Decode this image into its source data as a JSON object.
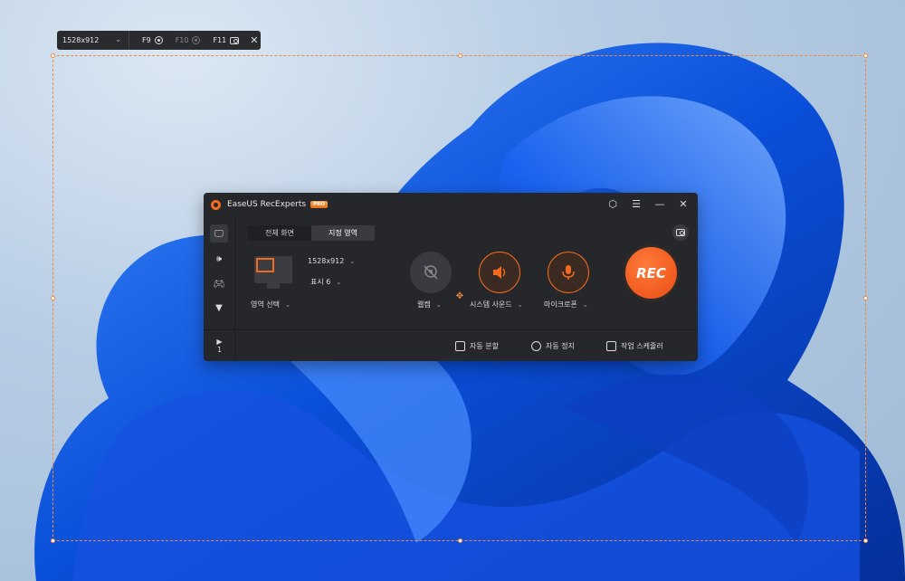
{
  "mini_toolbar": {
    "resolution": "1528x912",
    "items": [
      {
        "key": "F9",
        "icon": "record-circle-icon"
      },
      {
        "key": "F10",
        "icon": "pause-circle-icon"
      },
      {
        "key": "F11",
        "icon": "camera-icon"
      }
    ],
    "close_icon": "close-icon"
  },
  "app": {
    "title": "EaseUS RecExperts",
    "badge": "PRO",
    "window_controls": [
      "settings-icon",
      "menu-icon",
      "minimize-icon",
      "close-icon"
    ],
    "sidebar": {
      "items": [
        "monitor-icon",
        "speaker-icon",
        "gamepad-icon",
        "more-down-icon"
      ],
      "files_count": "1"
    },
    "tabs": [
      {
        "label": "전체 화면",
        "active": false
      },
      {
        "label": "지정 영역",
        "active": true
      }
    ],
    "region": {
      "resolution": "1528x912",
      "display": "표시 6",
      "select_label": "영역 선택"
    },
    "buttons": {
      "webcam": "웹캠",
      "system_sound": "시스템 사운드",
      "microphone": "마이크로폰",
      "rec": "REC"
    },
    "bottom": {
      "auto_split": "자동 분할",
      "auto_stop": "자동 정지",
      "task_scheduler": "작업 스케쥴러"
    }
  },
  "colors": {
    "accent": "#f26b1d",
    "window_bg": "#26272b",
    "selection": "#f08a3c"
  }
}
